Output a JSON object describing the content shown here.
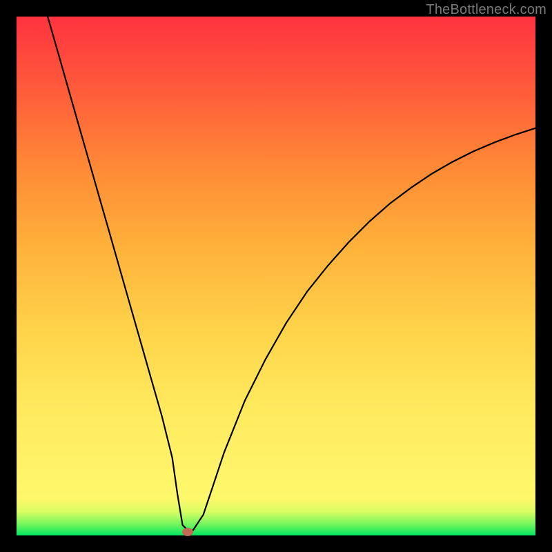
{
  "branding": {
    "site_label": "TheBottleneck.com"
  },
  "colors": {
    "frame": "#000000",
    "gradient_top": "#ff333f",
    "gradient_mid_high": "#ff8c36",
    "gradient_mid": "#ffe95d",
    "gradient_low": "#d8fd63",
    "gradient_bottom": "#00e661",
    "curve": "#000000",
    "dot": "#c36a57",
    "site_text": "#7a7a7a"
  },
  "chart_data": {
    "type": "line",
    "title": "",
    "xlabel": "",
    "ylabel": "",
    "xlim": [
      0,
      100
    ],
    "ylim": [
      0,
      100
    ],
    "series": [
      {
        "name": "curve",
        "x": [
          6,
          8,
          10,
          12,
          14,
          16,
          18,
          20,
          22,
          24,
          26,
          28,
          30,
          31,
          32,
          33,
          34,
          36,
          38,
          40,
          44,
          48,
          52,
          56,
          60,
          64,
          68,
          72,
          76,
          80,
          84,
          88,
          92,
          96,
          100
        ],
        "y": [
          100,
          93,
          86,
          79,
          72,
          65,
          58,
          51,
          44,
          37,
          30,
          23,
          15,
          8,
          2,
          1,
          1,
          4,
          10,
          16,
          26,
          34,
          41,
          47,
          52,
          56.5,
          60.5,
          64,
          67,
          69.7,
          72,
          74,
          75.7,
          77.2,
          78.5
        ]
      }
    ],
    "marker": {
      "x": 33,
      "y": 0.7
    },
    "grid": false,
    "legend": false
  }
}
